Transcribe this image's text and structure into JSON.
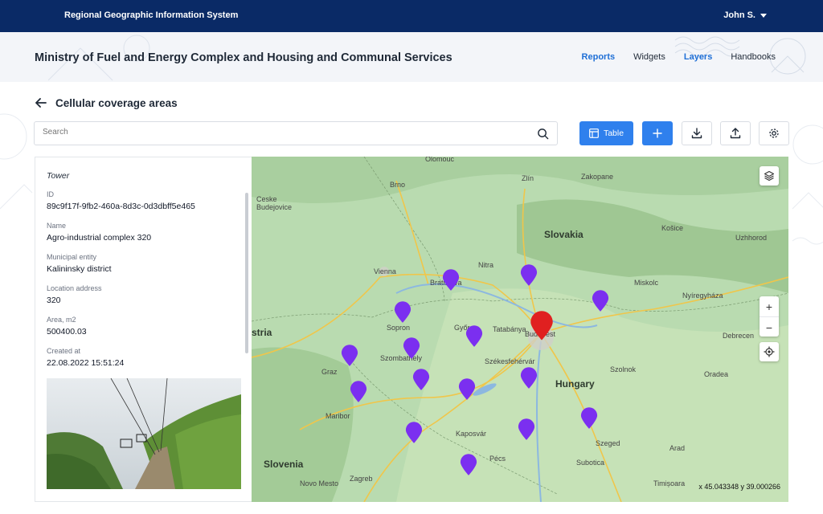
{
  "topbar": {
    "app_title": "Regional Geographic Information System",
    "user": "John S."
  },
  "header": {
    "org_title": "Ministry of Fuel and Energy Complex and Housing and Communal Services",
    "nav": [
      {
        "label": "Reports",
        "active": true
      },
      {
        "label": "Widgets",
        "active": false
      },
      {
        "label": "Layers",
        "active": true
      },
      {
        "label": "Handbooks",
        "active": false
      }
    ]
  },
  "page": {
    "title": "Cellular coverage areas"
  },
  "search": {
    "placeholder": "Search"
  },
  "toolbar": {
    "table_label": "Table"
  },
  "details": {
    "type": "Tower",
    "fields": [
      {
        "label": "ID",
        "value": "89c9f17f-9fb2-460a-8d3c-0d3dbff5e465"
      },
      {
        "label": "Name",
        "value": "Agro-industrial complex 320"
      },
      {
        "label": "Municipal entity",
        "value": "Kalininsky district"
      },
      {
        "label": "Location address",
        "value": "320"
      },
      {
        "label": "Area, m2",
        "value": "500400.03"
      },
      {
        "label": "Created at",
        "value": "22.08.2022 15:51:24"
      }
    ]
  },
  "map": {
    "coordinates": "x 45.043348  y 39.000266",
    "countries": [
      "Slovakia",
      "Hungary",
      "Slovenia",
      "stria"
    ],
    "cities": [
      "Brno",
      "Vienna",
      "Bratislava",
      "Graz",
      "Zagreb",
      "Budapest",
      "Košice",
      "Szeged",
      "Timișoara",
      "Oradea",
      "Miskolc",
      "Pécs",
      "Győr",
      "Subotica",
      "Arad",
      "Uzhhorod",
      "Zlín",
      "Nitra",
      "Maribor",
      "Kaposvár",
      "Nyíregyháza",
      "Szolnok",
      "Tatabánya",
      "Székesfehérvár",
      "Szombathely",
      "Sopron",
      "Debrecen",
      "Zakopane",
      "Olomouc",
      "Ceske Budejovice",
      "Novo Mesto"
    ],
    "colors": {
      "marker": "#7b2ff0",
      "selected_marker": "#e02020",
      "land": "#b9dbb0"
    }
  }
}
